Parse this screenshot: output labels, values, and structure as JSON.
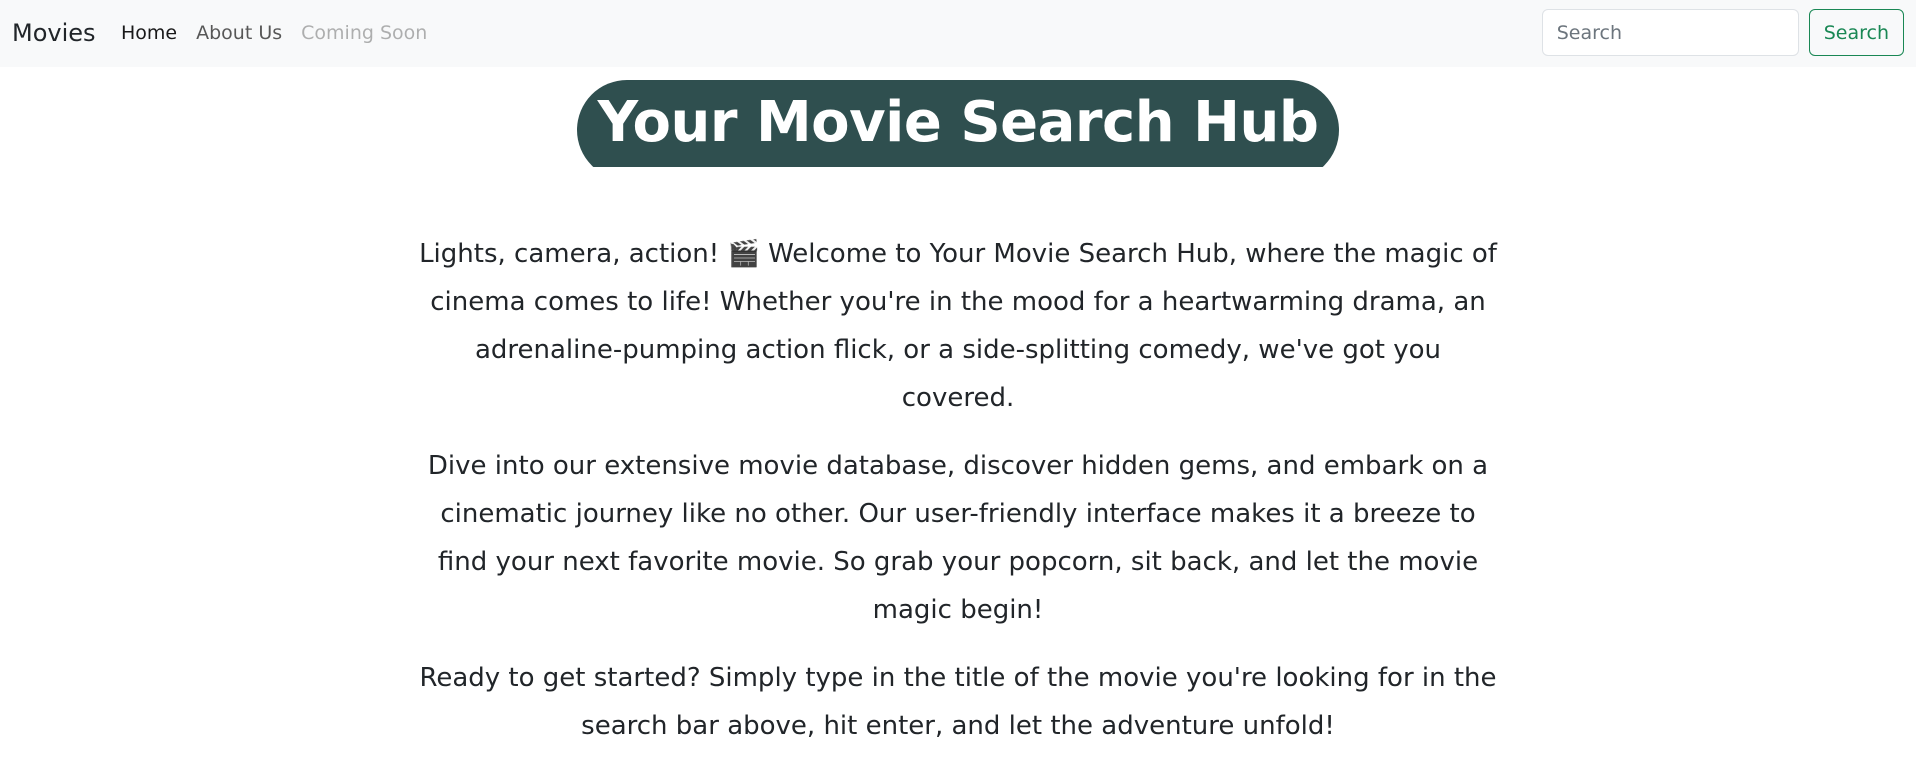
{
  "navbar": {
    "brand": "Movies",
    "links": [
      {
        "label": "Home",
        "state": "active"
      },
      {
        "label": "About Us",
        "state": "normal"
      },
      {
        "label": "Coming Soon",
        "state": "disabled"
      }
    ],
    "search": {
      "placeholder": "Search",
      "value": "",
      "button_label": "Search"
    }
  },
  "hero": {
    "title": "Your Movie Search Hub"
  },
  "content": {
    "paragraphs": [
      "Lights, camera, action! 🎬 Welcome to Your Movie Search Hub, where the magic of cinema comes to life! Whether you're in the mood for a heartwarming drama, an adrenaline-pumping action flick, or a side-splitting comedy, we've got you covered.",
      "Dive into our extensive movie database, discover hidden gems, and embark on a cinematic journey like no other. Our user-friendly interface makes it a breeze to find your next favorite movie. So grab your popcorn, sit back, and let the movie magic begin!",
      "Ready to get started? Simply type in the title of the movie you're looking for in the search bar above, hit enter, and let the adventure unfold!"
    ]
  },
  "colors": {
    "navbar_bg": "#f8f9fa",
    "hero_bg": "#2f4f4f",
    "accent_green": "#198754"
  }
}
